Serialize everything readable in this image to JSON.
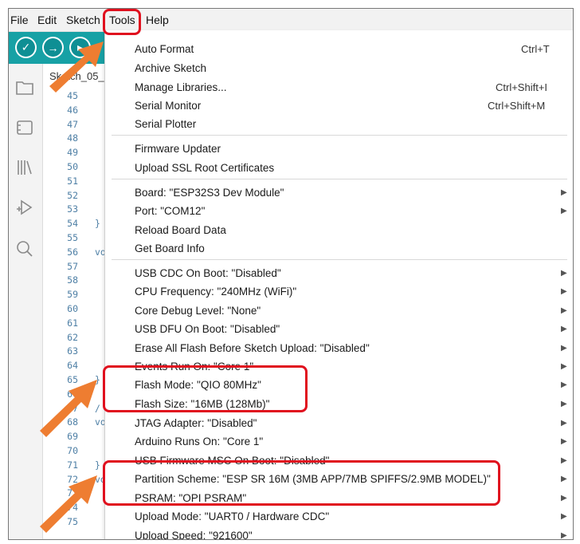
{
  "menubar": {
    "items": [
      "File",
      "Edit",
      "Sketch",
      "Tools",
      "Help"
    ]
  },
  "toolbar": {
    "verify_icon": "check-icon",
    "upload_icon": "arrow-right-icon",
    "debug_icon": "debug-icon"
  },
  "sidebar": {
    "icons": [
      "folder-icon",
      "board-icon",
      "library-icon",
      "debug-icon",
      "search-icon"
    ]
  },
  "editor": {
    "tab_label": "Sketch_05_1",
    "line_numbers": [
      "45",
      "46",
      "47",
      "48",
      "49",
      "50",
      "51",
      "52",
      "53",
      "54",
      "55",
      "56",
      "57",
      "58",
      "59",
      "60",
      "61",
      "62",
      "63",
      "64",
      "65",
      "66",
      "67",
      "68",
      "69",
      "70",
      "71",
      "72",
      "73",
      "74",
      "75"
    ],
    "code_fragments": {
      "54": "}",
      "56": "vo",
      "65": "}",
      "67": "/",
      "68": "vo",
      "71": "}",
      "72": "vo"
    }
  },
  "tools_menu": {
    "group1": [
      {
        "label": "Auto Format",
        "shortcut": "Ctrl+T"
      },
      {
        "label": "Archive Sketch",
        "shortcut": ""
      },
      {
        "label": "Manage Libraries...",
        "shortcut": "Ctrl+Shift+I"
      },
      {
        "label": "Serial Monitor",
        "shortcut": "Ctrl+Shift+M"
      },
      {
        "label": "Serial Plotter",
        "shortcut": ""
      }
    ],
    "group2": [
      {
        "label": "Firmware Updater"
      },
      {
        "label": "Upload SSL Root Certificates"
      }
    ],
    "group3": [
      {
        "label": "Board: \"ESP32S3 Dev Module\"",
        "submenu": true
      },
      {
        "label": "Port: \"COM12\"",
        "submenu": true
      },
      {
        "label": "Reload Board Data",
        "submenu": false
      },
      {
        "label": "Get Board Info",
        "submenu": false
      }
    ],
    "group4": [
      {
        "label": "USB CDC On Boot: \"Disabled\""
      },
      {
        "label": "CPU Frequency: \"240MHz (WiFi)\""
      },
      {
        "label": "Core Debug Level: \"None\""
      },
      {
        "label": "USB DFU On Boot: \"Disabled\""
      },
      {
        "label": "Erase All Flash Before Sketch Upload: \"Disabled\""
      },
      {
        "label": "Events Run On: \"Core 1\""
      },
      {
        "label": "Flash Mode: \"QIO 80MHz\""
      },
      {
        "label": "Flash Size: \"16MB (128Mb)\""
      },
      {
        "label": "JTAG Adapter: \"Disabled\""
      },
      {
        "label": "Arduino Runs On: \"Core 1\""
      },
      {
        "label": "USB Firmware MSC On Boot: \"Disabled\""
      },
      {
        "label": "Partition Scheme: \"ESP SR 16M (3MB APP/7MB SPIFFS/2.9MB MODEL)\""
      },
      {
        "label": "PSRAM: \"OPI PSRAM\""
      },
      {
        "label": "Upload Mode: \"UART0 / Hardware CDC\""
      },
      {
        "label": "Upload Speed: \"921600\""
      }
    ],
    "submenu_glyph": "▶"
  },
  "colors": {
    "toolbar": "#17a1a5",
    "highlight": "#e0101e",
    "arrow": "#ee7d31"
  }
}
